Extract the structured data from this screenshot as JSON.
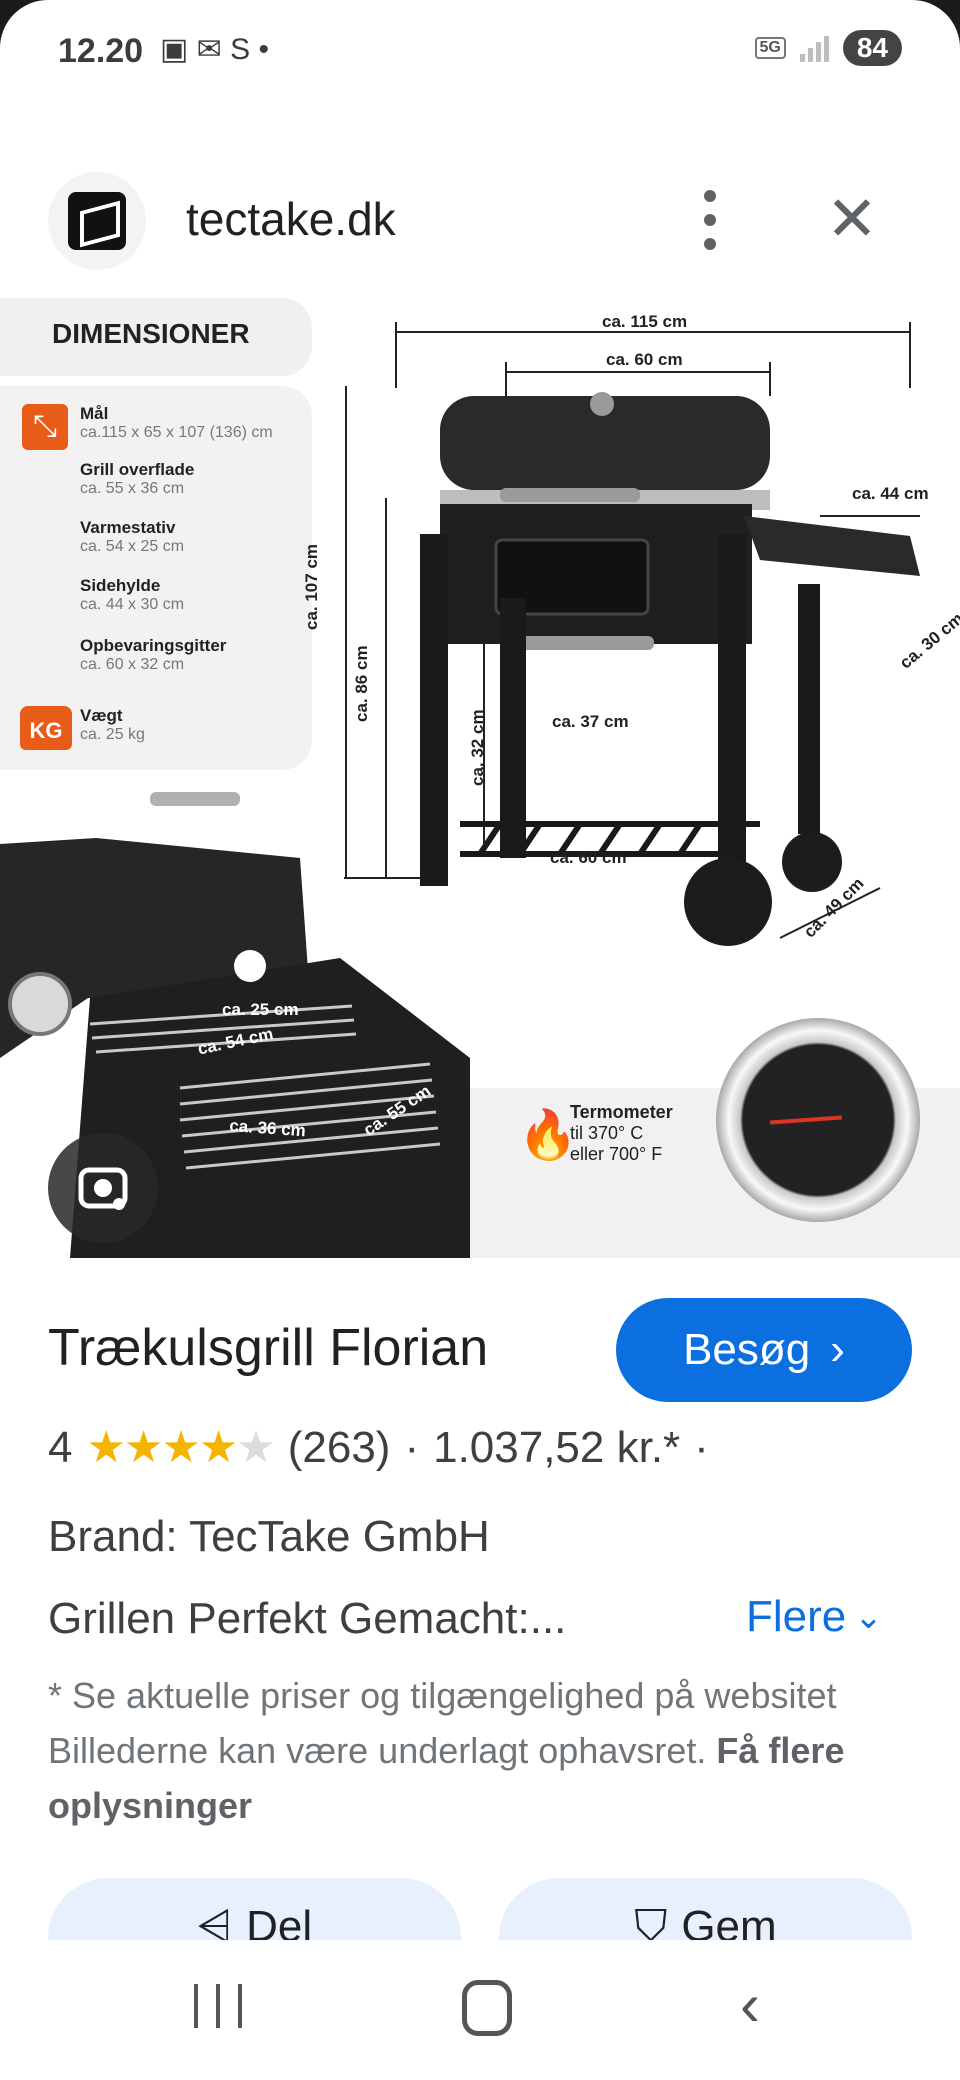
{
  "status_bar": {
    "time": "12.20",
    "icons_left": "▣ ✉ S •",
    "network": "5G",
    "battery": "84"
  },
  "site": {
    "name": "tectake.dk",
    "logo_icon": "tectake-logo-icon"
  },
  "image": {
    "dim_title": "DIMENSIONER",
    "specs": [
      {
        "label": "Mål",
        "value": "ca.115 x 65 x 107 (136) cm"
      },
      {
        "label": "Grill overflade",
        "value": "ca. 55 x 36 cm"
      },
      {
        "label": "Varmestativ",
        "value": "ca. 54 x 25 cm"
      },
      {
        "label": "Sidehylde",
        "value": "ca. 44 x 30 cm"
      },
      {
        "label": "Opbevaringsgitter",
        "value": "ca. 60 x 32 cm"
      },
      {
        "label": "Vægt",
        "value": "ca. 25 kg"
      }
    ],
    "kg_badge": "KG",
    "dimensions": {
      "width_total": "ca. 115 cm",
      "width_grill": "ca. 60 cm",
      "height_total": "ca. 107 cm",
      "height_work": "ca. 86 cm",
      "height_shelf": "ca. 32 cm",
      "inner": "ca. 37 cm",
      "shelf_width": "ca. 60 cm",
      "depth": "ca. 49 cm",
      "side_width": "ca. 44 cm",
      "side_depth": "ca. 30 cm",
      "rack_depth": "ca. 25 cm",
      "rack_width": "ca. 54 cm",
      "grate_depth": "ca. 36 cm",
      "grate_width": "ca. 55 cm"
    },
    "thermometer": {
      "title": "Termometer",
      "line1": "til 370° C",
      "line2": "eller 700° F"
    }
  },
  "product": {
    "title": "Trækulsgrill Florian",
    "visit_label": "Besøg",
    "rating": "4",
    "rating_value": 4,
    "rating_max": 5,
    "review_count": "(263)",
    "price": "1.037,52 kr.*",
    "brand": "Brand: TecTake GmbH",
    "description": "Grillen Perfekt Gemacht:...",
    "more_label": "Flere",
    "disclaimer": "* Se aktuelle priser og tilgængelighed på websitet Billederne kan være underlagt ophavsret.",
    "disclaimer_link": "Få flere oplysninger"
  },
  "actions": {
    "share": "Del",
    "save": "Gem"
  },
  "colors": {
    "accent": "#0b6fe0",
    "star": "#f5b400",
    "orange": "#e85c1a"
  }
}
